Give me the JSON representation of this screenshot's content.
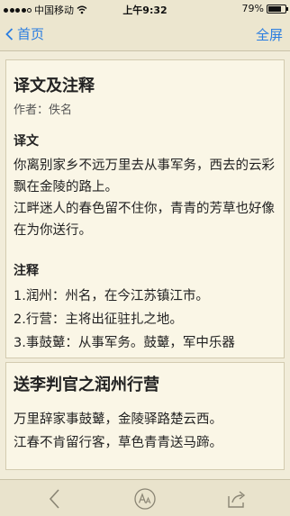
{
  "status": {
    "carrier": "中国移动",
    "time": "上午9:32",
    "battery": "79%",
    "battery_level": 0.79
  },
  "nav": {
    "back_label": "首页",
    "fullscreen_label": "全屏"
  },
  "translation_card": {
    "title": "译文及注释",
    "author": "作者：佚名",
    "translation_heading": "译文",
    "translation_paragraphs": [
      "你离别家乡不远万里去从事军务，西去的云彩飘在金陵的路上。",
      "江畔迷人的春色留不住你，青青的芳草也好像在为你送行。"
    ],
    "notes_heading": "注释",
    "notes": [
      "1.润州：州名，在今江苏镇江市。",
      "2.行营：主将出征驻扎之地。",
      "3.事鼓鼙：从事军务。鼓鼙，军中乐器"
    ]
  },
  "poem_card": {
    "title": "送李判官之润州行营",
    "lines": [
      "万里辞家事鼓鼙，金陵驿路楚云西。",
      "江春不肯留行客，草色青青送马蹄。"
    ]
  },
  "toolbar": {
    "icons": [
      "back-icon",
      "font-size-icon",
      "share-icon"
    ]
  },
  "colors": {
    "accent": "#2a7de1",
    "background": "#f1ecd9",
    "card": "#faf6e6"
  }
}
